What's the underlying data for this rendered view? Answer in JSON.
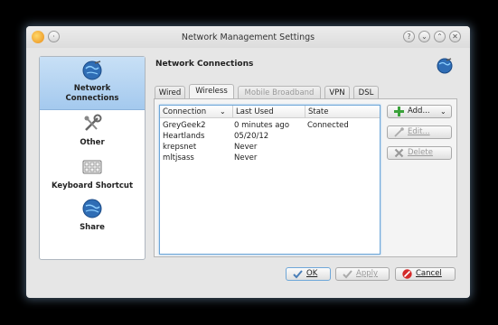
{
  "window": {
    "title": "Network Management Settings"
  },
  "sidebar": {
    "items": [
      {
        "label_line1": "Network",
        "label_line2": "Connections",
        "icon": "network-globe-icon"
      },
      {
        "label": "Other",
        "icon": "tools-icon"
      },
      {
        "label": "Keyboard Shortcut",
        "icon": "keyboard-icon"
      },
      {
        "label": "Share",
        "icon": "share-globe-icon"
      }
    ]
  },
  "section": {
    "title": "Network Connections"
  },
  "tabs": [
    {
      "label": "Wired",
      "state": "normal"
    },
    {
      "label": "Wireless",
      "state": "active"
    },
    {
      "label": "Mobile Broadband",
      "state": "disabled"
    },
    {
      "label": "VPN",
      "state": "normal"
    },
    {
      "label": "DSL",
      "state": "normal"
    }
  ],
  "table": {
    "headers": [
      "Connection",
      "Last Used",
      "State"
    ],
    "rows": [
      {
        "connection": "GreyGeek2",
        "last_used": "0 minutes ago",
        "state": "Connected"
      },
      {
        "connection": "Heartlands",
        "last_used": "05/20/12",
        "state": ""
      },
      {
        "connection": "krepsnet",
        "last_used": "Never",
        "state": ""
      },
      {
        "connection": "mltjsass",
        "last_used": "Never",
        "state": ""
      }
    ]
  },
  "actions": {
    "add": "Add...",
    "edit": "Edit...",
    "delete": "Delete"
  },
  "dialog_buttons": {
    "ok": "OK",
    "apply": "Apply",
    "cancel": "Cancel"
  },
  "colors": {
    "selection": "#a4c9ee",
    "focus_border": "#6ea7d8",
    "add_green": "#3aa23a",
    "cancel_red": "#d42a2a"
  }
}
